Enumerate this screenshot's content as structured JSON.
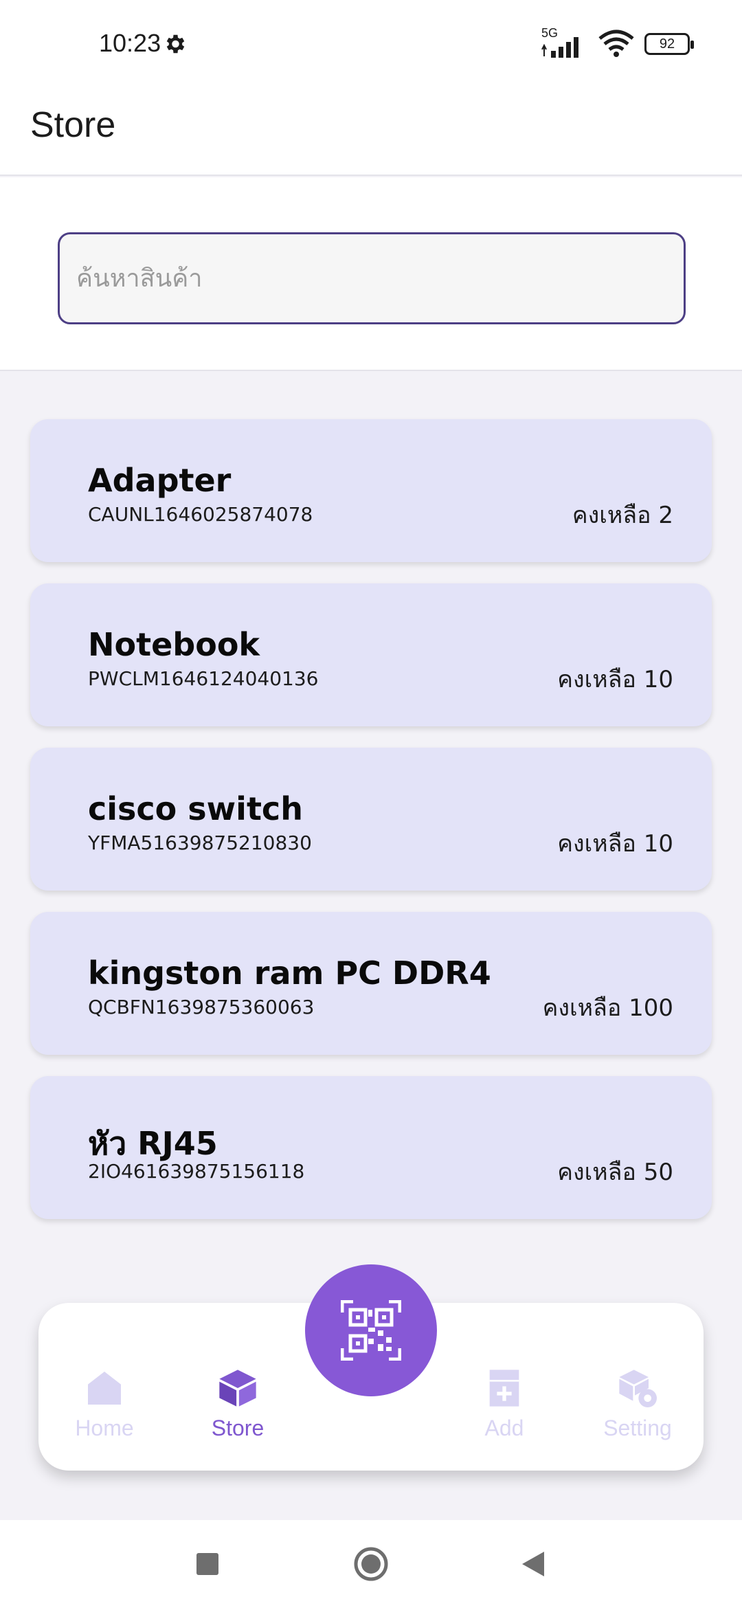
{
  "status_bar": {
    "time": "10:23",
    "network": "5G",
    "battery": "92"
  },
  "app_bar": {
    "title": "Store"
  },
  "search": {
    "placeholder": "ค้นหาสินค้า"
  },
  "products": [
    {
      "name": "Adapter",
      "code": "CAUNL1646025874078",
      "stock": "คงเหลือ 2"
    },
    {
      "name": "Notebook",
      "code": "PWCLM1646124040136",
      "stock": "คงเหลือ 10"
    },
    {
      "name": "cisco switch",
      "code": "YFMA51639875210830",
      "stock": "คงเหลือ 10"
    },
    {
      "name": "kingston ram PC DDR4",
      "code": "QCBFN1639875360063",
      "stock": "คงเหลือ 100"
    },
    {
      "name": "หัว RJ45",
      "code": "2IO461639875156118",
      "stock": "คงเหลือ 50"
    }
  ],
  "bottom_nav": {
    "items": [
      {
        "label": "Home",
        "icon": "home-icon",
        "active": false
      },
      {
        "label": "Store",
        "icon": "box-icon",
        "active": true
      },
      {
        "label": "Add",
        "icon": "add-box-icon",
        "active": false
      },
      {
        "label": "Setting",
        "icon": "settings-box-icon",
        "active": false
      }
    ],
    "fab_icon": "qr-code-icon"
  },
  "colors": {
    "accent": "#8758d6",
    "card_bg": "#e3e3f8",
    "search_border": "#4d3f85"
  }
}
